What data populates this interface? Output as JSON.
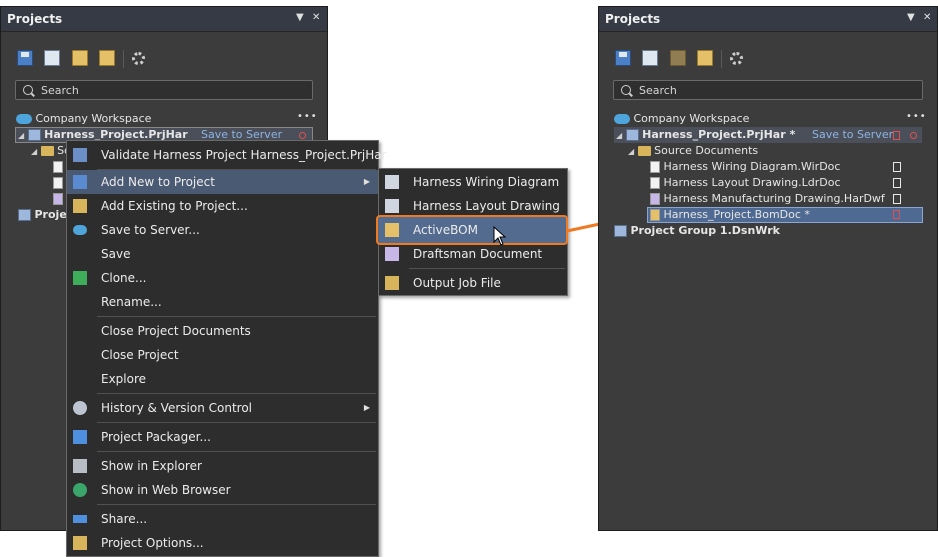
{
  "panel_title": "Projects",
  "search_placeholder": "Search",
  "left": {
    "workspace": "Company Workspace",
    "project": "Harness_Project.PrjHar",
    "save_to_server": "Save to Server",
    "source_partial": "So",
    "group_partial": "Projec"
  },
  "context_menu": [
    {
      "label": "Validate Harness Project Harness_Project.PrjHar",
      "icon": "validate-icon"
    },
    {
      "label": "Add New to Project",
      "icon": "add-new-icon",
      "submenu": true
    },
    {
      "label": "Add Existing to Project...",
      "icon": "add-existing-icon"
    },
    {
      "label": "Save to Server...",
      "icon": "cloud-icon"
    },
    {
      "label": "Save",
      "icon": ""
    },
    {
      "label": "Clone...",
      "icon": "clone-icon"
    },
    {
      "label": "Rename...",
      "icon": ""
    },
    {
      "label": "Close Project Documents",
      "icon": ""
    },
    {
      "label": "Close Project",
      "icon": ""
    },
    {
      "label": "Explore",
      "icon": ""
    },
    {
      "label": "History & Version Control",
      "icon": "history-icon",
      "submenu": true
    },
    {
      "label": "Project Packager...",
      "icon": "packager-icon"
    },
    {
      "label": "Show in Explorer",
      "icon": "explorer-icon"
    },
    {
      "label": "Show in Web Browser",
      "icon": "globe-icon"
    },
    {
      "label": "Share...",
      "icon": "share-icon"
    },
    {
      "label": "Project Options...",
      "icon": "options-icon"
    }
  ],
  "submenu": [
    {
      "label": "Harness Wiring Diagram",
      "icon": "wiring-icon"
    },
    {
      "label": "Harness Layout Drawing",
      "icon": "layout-icon"
    },
    {
      "label": "ActiveBOM",
      "icon": "bom-icon"
    },
    {
      "label": "Draftsman Document",
      "icon": "draftsman-icon"
    },
    {
      "label": "Output Job File",
      "icon": "outjob-icon"
    }
  ],
  "right": {
    "workspace": "Company Workspace",
    "project": "Harness_Project.PrjHar *",
    "save_to_server": "Save to Server",
    "source_documents": "Source Documents",
    "docs": [
      "Harness Wiring Diagram.WirDoc",
      "Harness Layout Drawing.LdrDoc",
      "Harness Manufacturing Drawing.HarDwf",
      "Harness_Project.BomDoc *"
    ],
    "group": "Project Group 1.DsnWrk"
  },
  "colors": {
    "accent": "#f07a22",
    "highlight": "#4b5a73"
  }
}
